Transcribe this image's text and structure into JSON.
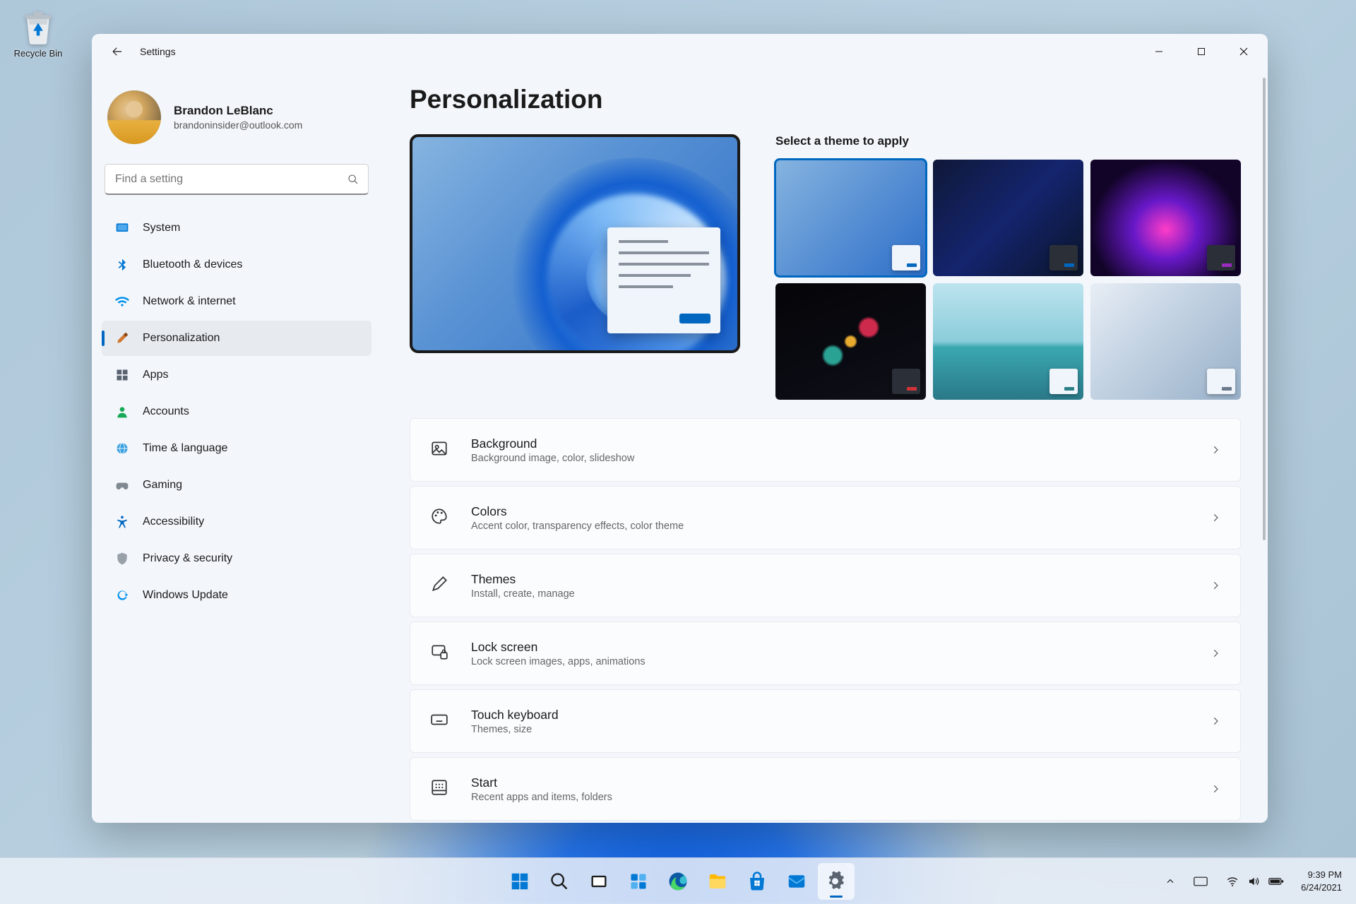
{
  "desktop": {
    "recycle_bin": "Recycle Bin"
  },
  "window": {
    "title": "Settings",
    "controls": {
      "min": "Minimize",
      "max": "Maximize",
      "close": "Close"
    }
  },
  "user": {
    "name": "Brandon LeBlanc",
    "email": "brandoninsider@outlook.com"
  },
  "search": {
    "placeholder": "Find a setting"
  },
  "nav": {
    "system": "System",
    "bluetooth": "Bluetooth & devices",
    "network": "Network & internet",
    "personalization": "Personalization",
    "apps": "Apps",
    "accounts": "Accounts",
    "time": "Time & language",
    "gaming": "Gaming",
    "accessibility": "Accessibility",
    "privacy": "Privacy & security",
    "update": "Windows Update"
  },
  "page": {
    "title": "Personalization",
    "themes_title": "Select a theme to apply"
  },
  "themes": [
    {
      "id": "light-bloom",
      "accent": "#0067c0",
      "selected": true
    },
    {
      "id": "dark-bloom",
      "accent": "#0067c0",
      "selected": false
    },
    {
      "id": "glow",
      "accent": "#9a2bbf",
      "selected": false
    },
    {
      "id": "captured-motion",
      "accent": "#d13438",
      "selected": false
    },
    {
      "id": "sunrise",
      "accent": "#2c8088",
      "selected": false
    },
    {
      "id": "flow",
      "accent": "#69788a",
      "selected": false
    }
  ],
  "settings": {
    "background": {
      "title": "Background",
      "sub": "Background image, color, slideshow"
    },
    "colors": {
      "title": "Colors",
      "sub": "Accent color, transparency effects, color theme"
    },
    "themes": {
      "title": "Themes",
      "sub": "Install, create, manage"
    },
    "lockscreen": {
      "title": "Lock screen",
      "sub": "Lock screen images, apps, animations"
    },
    "touchkb": {
      "title": "Touch keyboard",
      "sub": "Themes, size"
    },
    "start": {
      "title": "Start",
      "sub": "Recent apps and items, folders"
    }
  },
  "taskbar": {
    "time": "9:39 PM",
    "date": "6/24/2021"
  }
}
